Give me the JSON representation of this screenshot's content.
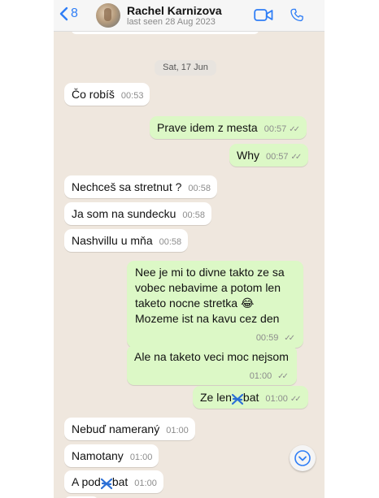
{
  "header": {
    "back_count": "8",
    "contact_name": "Rachel Karnizova",
    "last_seen": "last seen 28 Aug 2023"
  },
  "date_separator": "Sat, 17 Jun",
  "messages": [
    {
      "dir": "in",
      "text": "Čo robíš",
      "time": "00:53"
    },
    {
      "dir": "out",
      "text": "Prave idem z mesta",
      "time": "00:57"
    },
    {
      "dir": "out",
      "text": "Why",
      "time": "00:57"
    },
    {
      "dir": "in",
      "text": "Nechceš sa stretnut ?",
      "time": "00:58"
    },
    {
      "dir": "in",
      "text": "Ja som na sundecku",
      "time": "00:58"
    },
    {
      "dir": "in",
      "text": "Nashvillu u mňa",
      "time": "00:58"
    },
    {
      "dir": "out",
      "lines": [
        "Nee je mi to divne takto ze sa",
        "vobec nebavime a potom len",
        "taketo nocne stretka 😂",
        "Mozeme ist na kavu cez den"
      ],
      "time": "00:59"
    },
    {
      "dir": "out",
      "text": "Ale na taketo veci moc nejsom",
      "time": "01:00"
    },
    {
      "dir": "out",
      "text_before": "Ze len",
      "text_after": "bat",
      "time": "01:00"
    },
    {
      "dir": "in",
      "text": "Nebuď nameraný",
      "time": "01:00"
    },
    {
      "dir": "in",
      "text": "Namotany",
      "time": "01:00"
    },
    {
      "dir": "in",
      "text_before": "A pod",
      "text_after": "bat",
      "time": "01:00"
    }
  ],
  "colors": {
    "incoming_bubble": "#ffffff",
    "outgoing_bubble": "#dcf8c6",
    "chat_background": "#efe7de",
    "accent": "#2f7ef6",
    "scribble": "#2b6fd6"
  },
  "icons": [
    "back-chevron-icon",
    "video-call-icon",
    "phone-icon",
    "read-ticks-icon",
    "scroll-down-icon"
  ]
}
